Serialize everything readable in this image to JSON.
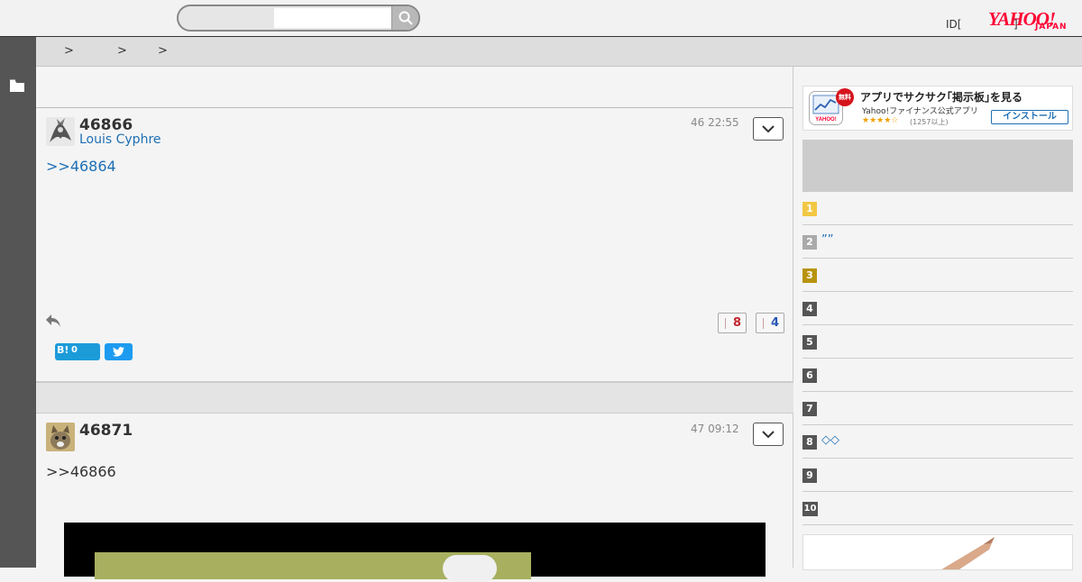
{
  "header": {
    "search": {
      "placeholder": ""
    },
    "login_label": "ID[",
    "logo_text": "YAHOO!",
    "logo_sub": "JAPAN",
    "close_bracket": "]"
  },
  "breadcrumb": {
    "sep1": ">",
    "sep2": ">",
    "sep3": ">"
  },
  "posts": [
    {
      "number": "46866",
      "author": "Louis Cyphre",
      "time": "46 22:55",
      "reply_ref": ">>46864",
      "likes": "8",
      "dislikes": "4",
      "hatena_label": "B!",
      "hatena_count": "0"
    },
    {
      "number": "46871",
      "author": "",
      "time": "47 09:12",
      "reply_ref": ">>46866"
    }
  ],
  "app_banner": {
    "badge": "無料",
    "title": "アプリでサクサク｢掲示板｣を見る",
    "subtitle": "Yahoo!ファイナンス公式アプリ",
    "stars": "★★★★☆",
    "review_count": "(1257以上)",
    "install_label": "インストール"
  },
  "ranking": [
    {
      "rank": "1",
      "text": "",
      "color": "#f2c744"
    },
    {
      "rank": "2",
      "text": "””",
      "color": "#aaaaaa"
    },
    {
      "rank": "3",
      "text": "",
      "color": "#b8930f"
    },
    {
      "rank": "4",
      "text": "",
      "color": "#555555"
    },
    {
      "rank": "5",
      "text": "",
      "color": "#555555"
    },
    {
      "rank": "6",
      "text": "",
      "color": "#555555"
    },
    {
      "rank": "7",
      "text": "",
      "color": "#555555"
    },
    {
      "rank": "8",
      "text": "◇◇",
      "color": "#555555"
    },
    {
      "rank": "9",
      "text": "",
      "color": "#555555"
    },
    {
      "rank": "10",
      "text": "",
      "color": "#555555"
    }
  ]
}
